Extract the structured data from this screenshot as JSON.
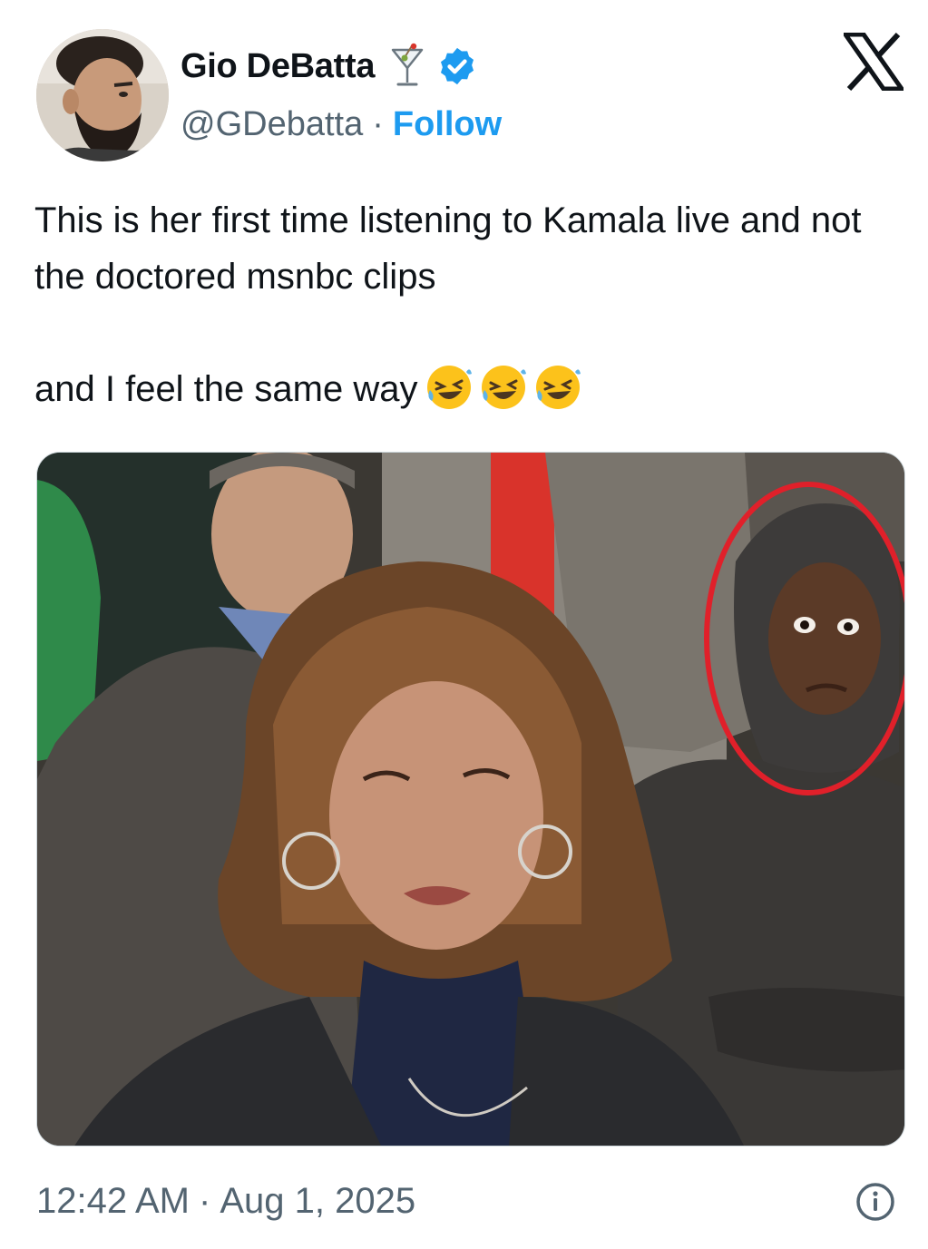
{
  "author": {
    "display_name": "Gio DeBatta",
    "handle": "@GDebatta",
    "separator": "·",
    "follow_label": "Follow",
    "name_icon": "martini-glass-icon",
    "badge_icon": "verified-badge-icon",
    "avatar_icon": "profile-photo"
  },
  "brand": {
    "logo_icon": "x-logo-icon"
  },
  "tweet": {
    "line1": "This is her first time listening to Kamala live and not the doctored msnbc clips",
    "line2": "and I feel the same way",
    "emojis": [
      "🤣",
      "🤣",
      "🤣"
    ],
    "media_description_icon": "attached-photo"
  },
  "footer": {
    "time": "12:42 AM",
    "separator": "·",
    "date": "Aug 1, 2025",
    "info_icon": "info-icon"
  },
  "colors": {
    "text": "#0f1419",
    "secondary": "#536471",
    "accent": "#1d9bf0",
    "highlight_circle": "#e0202a"
  }
}
